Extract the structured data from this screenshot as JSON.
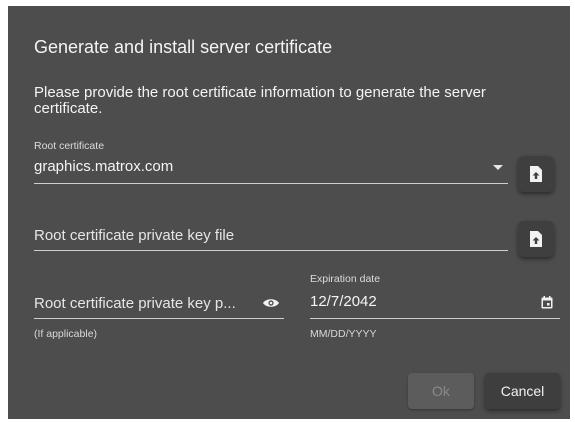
{
  "dialog": {
    "title": "Generate and install server certificate",
    "description": "Please provide the root certificate information to generate the server certificate."
  },
  "root_certificate": {
    "label": "Root certificate",
    "value": "graphics.matrox.com",
    "dropdown_icon": "chevron-down-icon",
    "upload_icon": "upload-file-icon"
  },
  "private_key_file": {
    "placeholder": "Root certificate private key file",
    "upload_icon": "upload-file-icon"
  },
  "private_key_password": {
    "placeholder": "Root certificate private key p...",
    "hint": "(If applicable)",
    "visibility_icon": "eye-icon"
  },
  "expiration_date": {
    "label": "Expiration date",
    "value": "12/7/2042",
    "hint": "MM/DD/YYYY",
    "calendar_icon": "calendar-icon"
  },
  "actions": {
    "ok_label": "Ok",
    "cancel_label": "Cancel"
  }
}
